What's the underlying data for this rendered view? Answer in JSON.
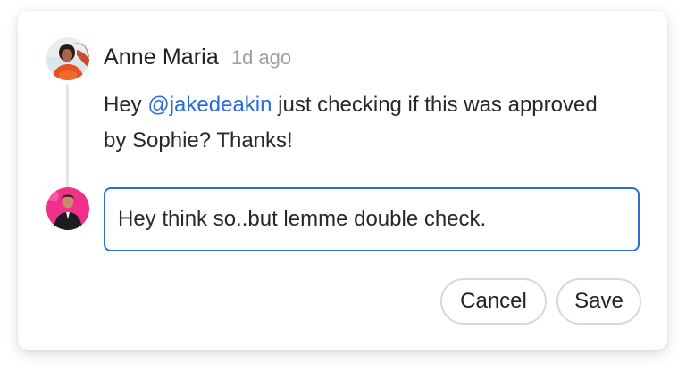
{
  "comment": {
    "author": "Anne Maria",
    "timestamp": "1d ago",
    "text_before": "Hey ",
    "mention": "@jakedeakin",
    "text_after": " just checking if this was approved by Sophie? Thanks!"
  },
  "reply": {
    "value": "Hey think so..but lemme double check."
  },
  "actions": {
    "cancel_label": "Cancel",
    "save_label": "Save"
  },
  "colors": {
    "mention": "#2d6bd7",
    "input_border": "#2d6fd6",
    "button_border": "#d6d8db",
    "thread_line": "#e3e5e8"
  }
}
